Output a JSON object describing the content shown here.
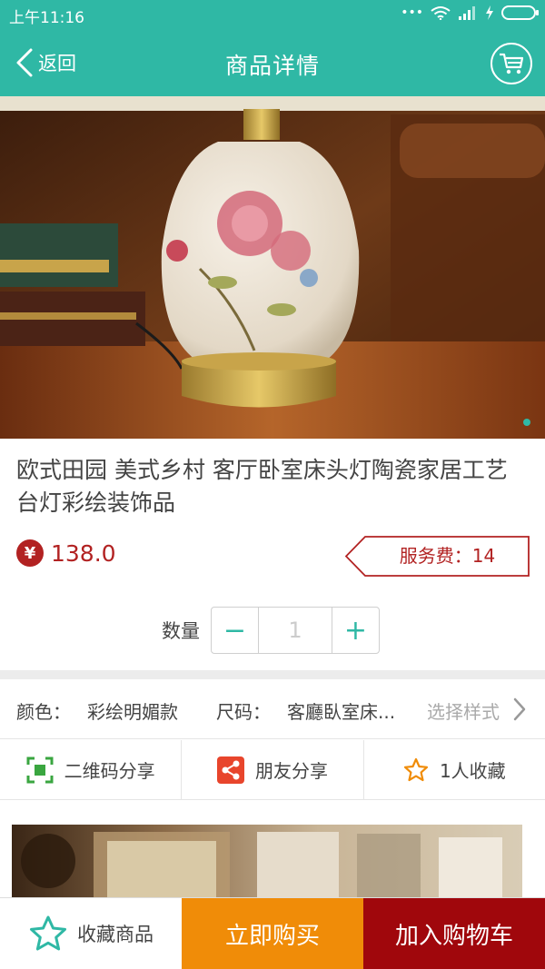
{
  "status_bar": {
    "time": "上午11:16",
    "icons": [
      "more-icon",
      "wifi-icon",
      "signal-icon",
      "charging-icon",
      "battery-icon"
    ]
  },
  "header": {
    "back_label": "返回",
    "title": "商品详情",
    "cart_icon": "cart-icon"
  },
  "gallery": {
    "accent": "#2fb8a5"
  },
  "product": {
    "title": "欧式田园 美式乡村 客厅卧室床头灯陶瓷家居工艺台灯彩绘装饰品",
    "currency_symbol": "¥",
    "price": "138.0",
    "service_fee": "服务费：14"
  },
  "quantity": {
    "label": "数量",
    "minus": "−",
    "value": "1",
    "plus": "+"
  },
  "specs": {
    "color_label": "颜色：",
    "color_value": "彩绘明媚款",
    "size_label": "尺码：",
    "size_value": "客廳臥室床...",
    "hint": "选择样式"
  },
  "share": {
    "qr": "二维码分享",
    "friends": "朋友分享",
    "favorites": "1人收藏"
  },
  "bottom": {
    "favorite": "收藏商品",
    "buy_now": "立即购买",
    "add_to_cart": "加入购物车"
  },
  "colors": {
    "primary": "#2fb8a5",
    "price": "#b22222",
    "buy": "#f08c08",
    "cart": "#a0070c"
  }
}
